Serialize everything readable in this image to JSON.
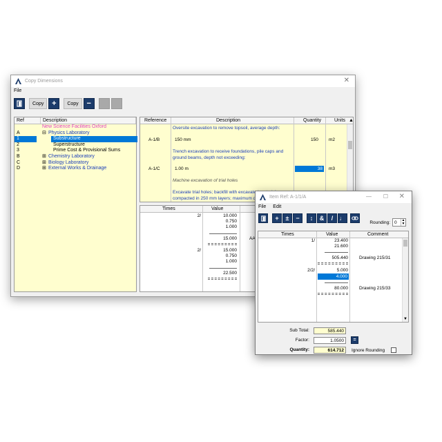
{
  "main_window": {
    "title": "Copy Dimensions",
    "menu": [
      "File"
    ],
    "toolbar": {
      "copy_label_1": "Copy",
      "copy_label_2": "Copy",
      "add_symbol": "+",
      "remove_symbol": "−"
    },
    "tree": {
      "headers": {
        "ref": "Ref",
        "description": "Description"
      },
      "rows": [
        {
          "ref": "",
          "desc": "New Science Facilities Oxford"
        },
        {
          "ref": "A",
          "desc": "Physics Laboratory"
        },
        {
          "ref": "1",
          "desc": "Substructure"
        },
        {
          "ref": "2",
          "desc": "Superstructure"
        },
        {
          "ref": "3",
          "desc": "Prime Cost & Provisional Sums"
        },
        {
          "ref": "B",
          "desc": "Chemistry Laboratory"
        },
        {
          "ref": "C",
          "desc": "Biology Laboratory"
        },
        {
          "ref": "D",
          "desc": "External Works & Drainage"
        }
      ]
    },
    "grid": {
      "headers": {
        "reference": "Reference",
        "description": "Description",
        "quantity": "Quantity",
        "units": "Units"
      },
      "lines": [
        "Oversite excavation to remove topsoil, average depth:",
        "150 mm",
        "Trench excavation to receive foundations, pile caps and",
        "ground beams, depth not exceeding:",
        "1.00 m",
        "Machine excavation of trial holes",
        "Excavate trial holes; backfill with excavated material",
        "compacted in 250 mm layers; maximum depth"
      ],
      "refs": [
        "A-1/B",
        "A-1/C"
      ],
      "quantities": [
        "150",
        "38"
      ],
      "units": [
        "m2",
        "m3"
      ]
    },
    "times_grid": {
      "headers": {
        "times": "Times",
        "value": "Value"
      },
      "times": [
        "2/",
        "2/"
      ],
      "values": [
        "10.000",
        "0.750",
        "1.000",
        "15.000",
        "15.000",
        "0.750",
        "1.000",
        "22.500"
      ],
      "tag": "AA"
    }
  },
  "dialog": {
    "title": "Item Ref: A-1/1/A",
    "menu": [
      "File",
      "Edit"
    ],
    "toolbar_symbols": [
      "+",
      "±",
      "−",
      "↕",
      "&",
      "/",
      "♩",
      "⛓"
    ],
    "rounding_label": "Rounding:",
    "rounding_value": "0",
    "grid": {
      "headers": {
        "times": "Times",
        "value": "Value",
        "comment": "Comment"
      },
      "times": [
        "1/",
        "2/2/"
      ],
      "values": [
        "23.400",
        "21.600",
        "505.440",
        "5.000",
        "4.000",
        "80.000"
      ],
      "comments": [
        "Drawing 215/31",
        "Drawing 215/33"
      ]
    },
    "totals": {
      "sub_total_label": "Sub Total:",
      "sub_total": "585.440",
      "factor_label": "Factor:",
      "factor": "1.0500",
      "quantity_label": "Quantity:",
      "quantity": "614.712",
      "ignore_rounding_label": "Ignore Rounding"
    }
  },
  "colors": {
    "toolbar_blue": "#1c3c6b",
    "selection": "#0078d7",
    "panel_yellow": "#fffecf",
    "tree_blue": "#1a3db8",
    "tree_magenta": "#e040c0"
  }
}
